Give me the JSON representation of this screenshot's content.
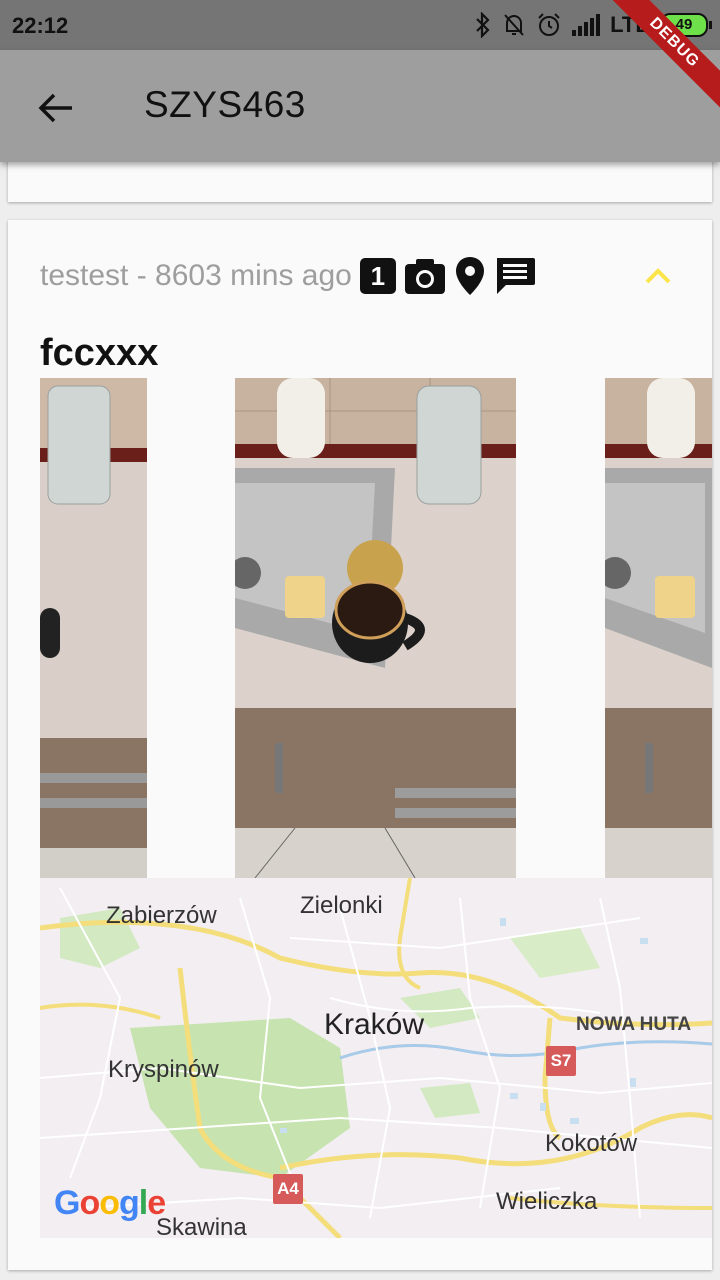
{
  "status_bar": {
    "time": "22:12",
    "network": "LTE",
    "battery": "49"
  },
  "app_bar": {
    "title": "SZYS463",
    "debug_banner": "DEBUG"
  },
  "card": {
    "meta": "testest - 8603 mins ago",
    "photo_count": "1",
    "name": "fccxxx",
    "icons": [
      "camera-icon",
      "location-pin-icon",
      "comment-icon",
      "chevron-up-icon"
    ],
    "chevron_color": "#fbe54a"
  },
  "map": {
    "labels": {
      "zabierzow": "Zabierzów",
      "zielonki": "Zielonki",
      "krakow": "Kraków",
      "nowa_huta": "NOWA HUTA",
      "kryspinow": "Kryspinów",
      "kokotow": "Kokotów",
      "wieliczka": "Wieliczka",
      "skawina": "Skawina"
    },
    "shields": {
      "s7": "S7",
      "a4": "A4"
    },
    "logo": "Google"
  }
}
